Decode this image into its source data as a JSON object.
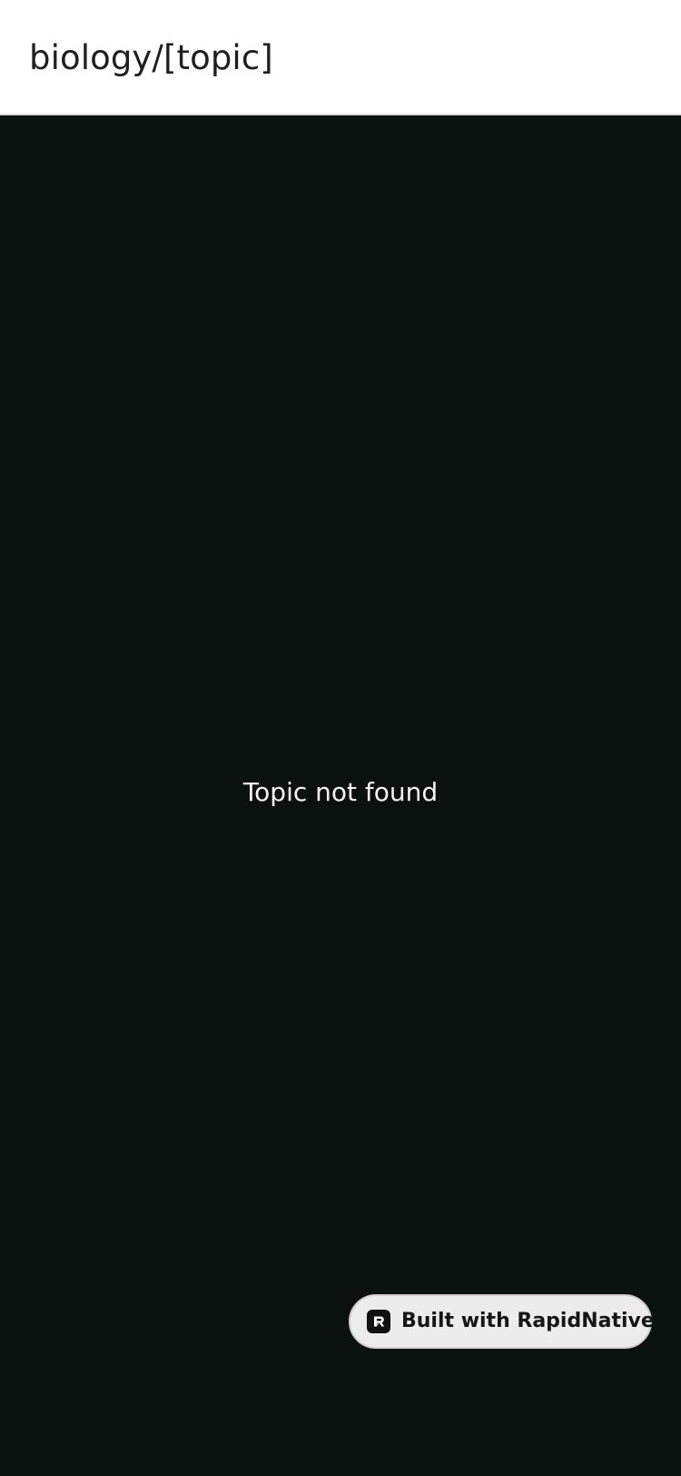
{
  "header": {
    "title": "biology/[topic]"
  },
  "main": {
    "empty_message": "Topic not found"
  },
  "badge": {
    "label": "Built with RapidNative",
    "logo_icon": "rapidnative-logo-icon"
  },
  "colors": {
    "header_background": "#ffffff",
    "page_background": "#0b110f",
    "badge_background": "#ececec"
  }
}
